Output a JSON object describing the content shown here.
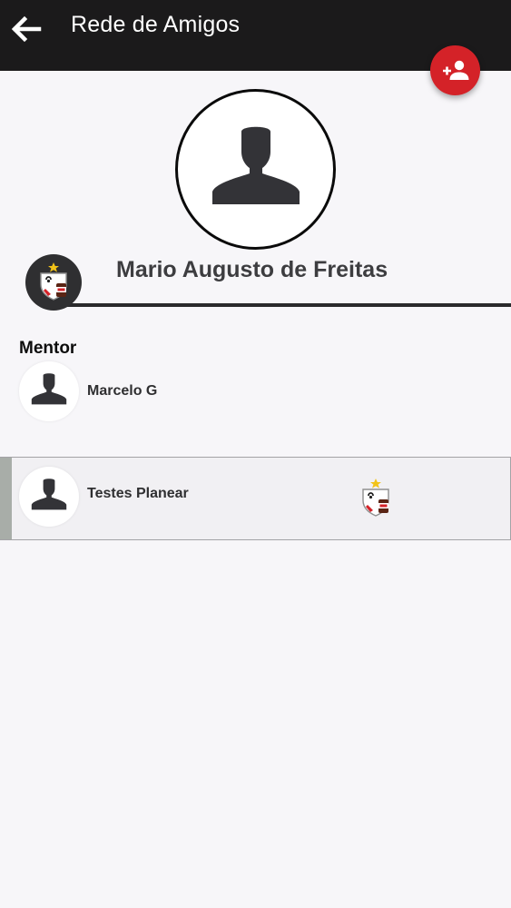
{
  "header": {
    "title": "Rede de Amigos",
    "back_icon": "arrow-left-icon",
    "add_friend_icon": "person-add-icon"
  },
  "colors": {
    "appbar": "#1b1a1b",
    "fab": "#d42228",
    "background": "#f7f6f9",
    "selected_row": "#f1f0f3"
  },
  "profile": {
    "name": "Mario Augusto de Freitas",
    "photo_icon": "person-silhouette-icon",
    "team_icon": "team-shield-icon"
  },
  "mentor": {
    "heading": "Mentor",
    "friends": [
      {
        "name": "Marcelo G",
        "avatar_icon": "person-silhouette-icon"
      },
      {
        "name": "Testes Planear",
        "avatar_icon": "person-silhouette-icon",
        "team_icon": "team-shield-icon"
      }
    ]
  }
}
